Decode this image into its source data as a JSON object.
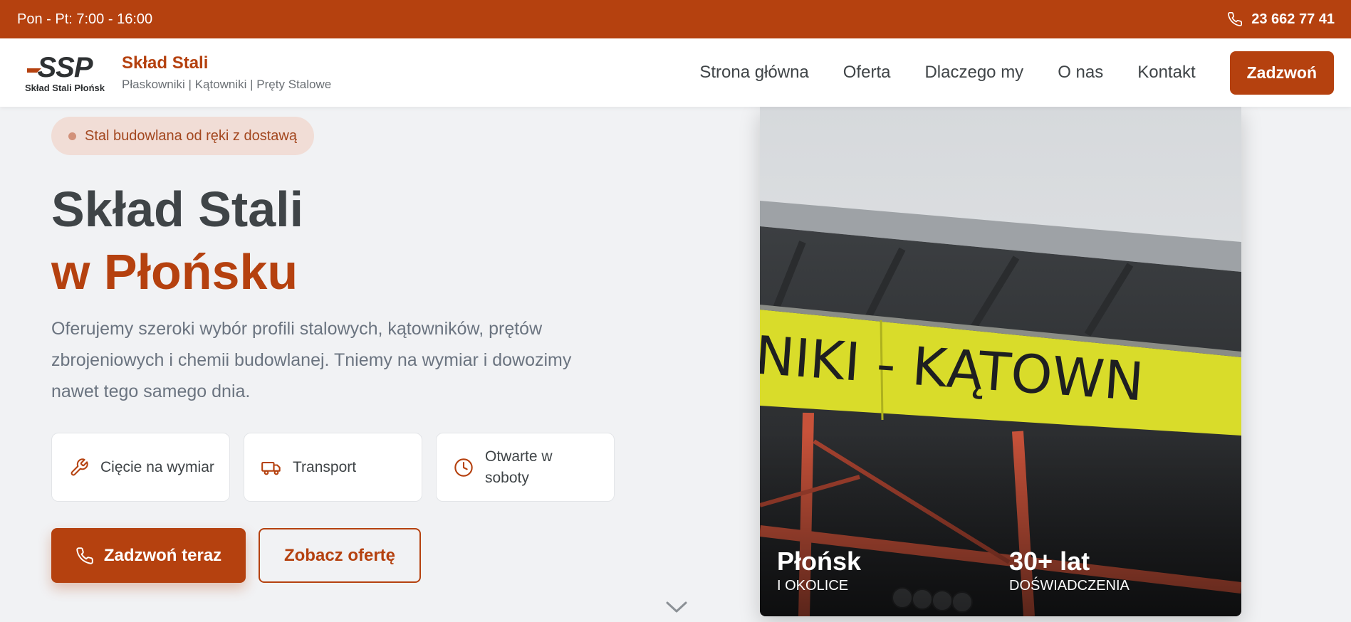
{
  "topbar": {
    "hours": "Pon - Pt: 7:00 - 16:00",
    "phone": "23 662 77 41"
  },
  "nav": {
    "logo_text": "SSP",
    "logo_caption": "Skład Stali Płońsk",
    "brand_name": "Skład Stali",
    "brand_tagline": "Płaskowniki | Kątowniki | Pręty Stalowe",
    "links": [
      "Strona główna",
      "Oferta",
      "Dlaczego my",
      "O nas",
      "Kontakt"
    ],
    "call_button": "Zadzwoń"
  },
  "hero": {
    "badge": "Stal budowlana od ręki z dostawą",
    "title_line1": "Skład Stali",
    "title_line2": "w Płońsku",
    "lead": "Oferujemy szeroki wybór profili stalowych, kątowników, prętów zbrojeniowych i chemii budowlanej. Tniemy na wymiar i dowozimy nawet tego samego dnia.",
    "features": [
      {
        "icon": "wrench-icon",
        "label": "Cięcie na wymiar"
      },
      {
        "icon": "truck-icon",
        "label": "Transport"
      },
      {
        "icon": "clock-icon",
        "label": "Otwarte w soboty"
      }
    ],
    "primary_button": "Zadzwoń teraz",
    "secondary_button": "Zobacz ofertę"
  },
  "photo": {
    "sign_text": "NIKI - KĄTOWN",
    "stat1_big": "Płońsk",
    "stat1_small": "I OKOLICE",
    "stat2_big": "30+ lat",
    "stat2_small": "DOŚWIADCZENIA"
  },
  "colors": {
    "accent": "#b5410f",
    "background": "#f1f2f4",
    "text_dark": "#3f4447",
    "text_muted": "#6b7480"
  }
}
